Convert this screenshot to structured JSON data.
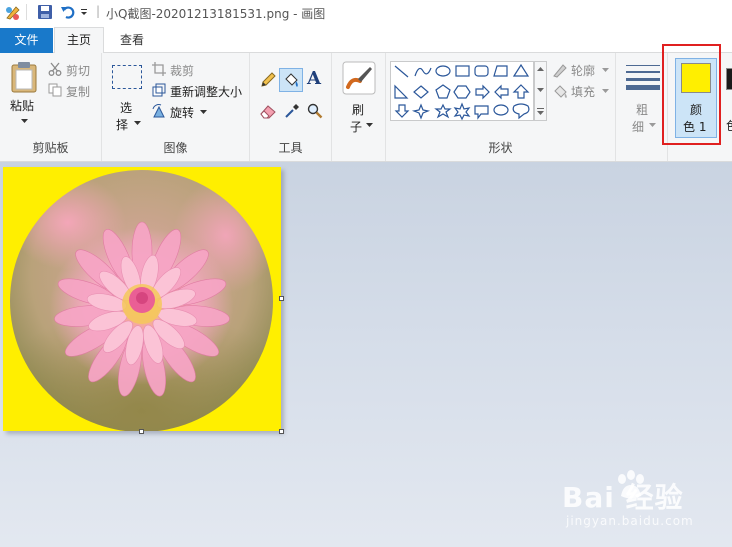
{
  "window": {
    "title": "小Q截图-20201213181531.png - 画图",
    "separator": "|"
  },
  "menu": {
    "file_tab": "文件",
    "home_tab": "主页",
    "view_tab": "查看"
  },
  "clipboard": {
    "paste": "粘贴",
    "cut": "剪切",
    "copy": "复制",
    "group_label": "剪贴板"
  },
  "image": {
    "select_line1": "选",
    "select_line2": "择",
    "crop": "裁剪",
    "resize": "重新调整大小",
    "rotate": "旋转",
    "group_label": "图像"
  },
  "tools": {
    "group_label": "工具",
    "text_tool_glyph": "A"
  },
  "brushes": {
    "line1": "刷",
    "line2": "子"
  },
  "shapes": {
    "outline": "轮廓",
    "fill": "填充",
    "group_label": "形状"
  },
  "size": {
    "line1": "粗",
    "line2": "细"
  },
  "colors": {
    "color1_line1": "颜",
    "color1_line2": "色 1",
    "color2_partial_line2": "色",
    "color1_value": "#ffef00",
    "color2_value": "#1a1a1a",
    "highlight": "#e02020"
  },
  "canvas": {
    "background": "#ffef00"
  },
  "watermark": {
    "brand": "Bai 经验",
    "url": "jingyan.baidu.com"
  }
}
